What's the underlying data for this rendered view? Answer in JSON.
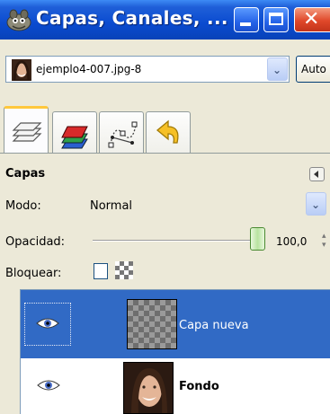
{
  "window": {
    "title": "Capas, Canales, ...",
    "colors": {
      "titlebar": "#0a4bd0",
      "close": "#e0482a"
    }
  },
  "image_selector": {
    "value": "ejemplo4-007.jpg-8",
    "auto_button": "Auto"
  },
  "tabs": [
    {
      "name": "capas",
      "icon": "layers-icon",
      "active": true
    },
    {
      "name": "canales",
      "icon": "channels-icon",
      "active": false
    },
    {
      "name": "rutas",
      "icon": "paths-icon",
      "active": false
    },
    {
      "name": "deshacer",
      "icon": "undo-history-icon",
      "active": false
    }
  ],
  "panel": {
    "title": "Capas",
    "mode_label": "Modo:",
    "mode_value": "Normal",
    "opacity_label": "Opacidad:",
    "opacity_value": "100,0",
    "opacity_fraction": 1.0,
    "lock_label": "Bloquear:"
  },
  "layers": [
    {
      "name": "Capa nueva",
      "visible": true,
      "selected": true,
      "thumbnail": "transparent"
    },
    {
      "name": "Fondo",
      "visible": true,
      "selected": false,
      "thumbnail": "portrait"
    }
  ],
  "accent_color": "#316ac5"
}
